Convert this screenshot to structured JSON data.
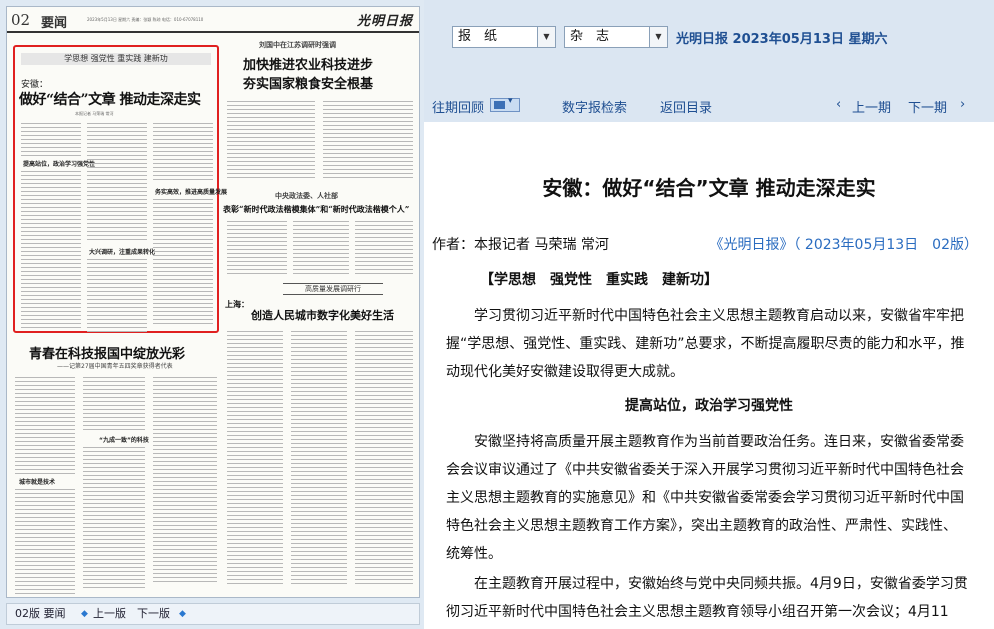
{
  "paper": {
    "page_number": "02",
    "section": "要闻",
    "header_date": "2023年5月13日 星期六 责编：张颖 陈琼 电话：010-67078110",
    "logo": "光明日报",
    "highlight": {
      "kicker": "学思想 强党性 重实践 建新功",
      "prefix": "安徽：",
      "title": "做好“结合”文章 推动走深走实",
      "byline": "本报记者 马荣瑞 常河",
      "sub1": "提高站位，政治学习强党性",
      "sub2": "大兴调研，注重成果转化",
      "sub3": "务实高效，推进高质量发展"
    },
    "top_right": {
      "pre": "刘国中在江苏调研时强调",
      "title1": "加快推进农业科技进步",
      "title2": "夯实国家粮食安全根基"
    },
    "mid_right": {
      "pre": "中央政法委、人社部",
      "title": "表彰“新时代政法楷模集体”和“新时代政法楷模个人”"
    },
    "feature": {
      "box": "高质量发展调研行",
      "pre": "上海：",
      "title": "创造人民城市数字化美好生活"
    },
    "bottom_left": {
      "title": "青春在科技报国中绽放光彩",
      "sub": "——记第27届中国青年五四奖章获得者代表",
      "inner_sub1": "“九成一致”的科技",
      "inner_sub2": "城市就是技术"
    },
    "nav": {
      "label": "02版 要闻",
      "prev": "上一版",
      "next": "下一版"
    }
  },
  "reader": {
    "select_paper": "报　纸",
    "select_magazine": "杂　志",
    "paper_name": "光明日报",
    "date": "2023年05月13日",
    "weekday": "星期六",
    "toolbar": {
      "archive": "往期回顾",
      "digital": "数字报检索",
      "back": "返回目录",
      "prev": "上一期",
      "next": "下一期"
    },
    "article": {
      "title": "安徽：做好“结合”文章 推动走深走实",
      "author": "作者：本报记者 马荣瑞 常河",
      "source": "《光明日报》（ 2023年05月13日　02版）",
      "kicker": "【学思想　强党性　重实践　建新功】",
      "p1": "学习贯彻习近平新时代中国特色社会主义思想主题教育启动以来，安徽省牢牢把握“学思想、强党性、重实践、建新功”总要求，不断提高履职尽责的能力和水平，推动现代化美好安徽建设取得更大成就。",
      "section1": "提高站位，政治学习强党性",
      "p2": "安徽坚持将高质量开展主题教育作为当前首要政治任务。连日来，安徽省委常委会会议审议通过了《中共安徽省委关于深入开展学习贯彻习近平新时代中国特色社会主义思想主题教育的实施意见》和《中共安徽省委常委会学习贯彻习近平新时代中国特色社会主义思想主题教育工作方案》，突出主题教育的政治性、严肃性、实践性、统筹性。",
      "p3": "在主题教育开展过程中，安徽始终与党中央同频共振。4月9日，安徽省委学习贯彻习近平新时代中国特色社会主义思想主题教育领导小组召开第一次会议；4月11"
    }
  }
}
